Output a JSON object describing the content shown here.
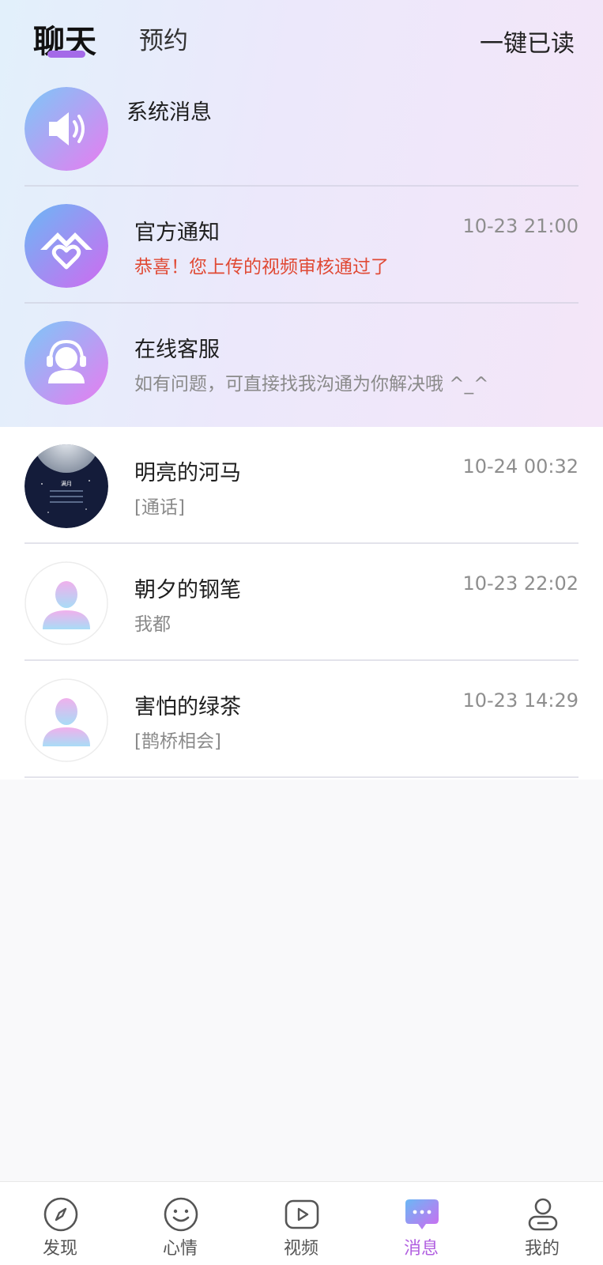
{
  "header": {
    "tabs": [
      {
        "label": "聊天",
        "active": true
      },
      {
        "label": "预约",
        "active": false
      }
    ],
    "mark_all_read": "一键已读"
  },
  "system_items": [
    {
      "name": "系统消息",
      "preview": "",
      "time": "",
      "icon": "speaker-icon"
    },
    {
      "name": "官方通知",
      "preview": "恭喜！您上传的视频审核通过了",
      "time": "10-23 21:00",
      "icon": "official-logo-icon"
    },
    {
      "name": "在线客服",
      "preview": "如有问题，可直接找我沟通为你解决哦 ^_^",
      "time": "",
      "icon": "headset-agent-icon"
    }
  ],
  "conversations": [
    {
      "name": "明亮的河马",
      "preview": "[通话]",
      "time": "10-24 00:32",
      "avatar_text": "满月"
    },
    {
      "name": "朝夕的钢笔",
      "preview": "我都",
      "time": "10-23 22:02"
    },
    {
      "name": "害怕的绿茶",
      "preview": "[鹊桥相会]",
      "time": "10-23 14:29"
    }
  ],
  "bottom_nav": [
    {
      "label": "发现",
      "icon": "compass-icon",
      "active": false
    },
    {
      "label": "心情",
      "icon": "smile-icon",
      "active": false
    },
    {
      "label": "视频",
      "icon": "video-play-icon",
      "active": false
    },
    {
      "label": "消息",
      "icon": "chat-bubble-icon",
      "active": true
    },
    {
      "label": "我的",
      "icon": "profile-icon",
      "active": false
    }
  ],
  "colors": {
    "accent": "#b15fe0",
    "notice_red": "#e04a35",
    "tab_underline": "#a46ae8"
  }
}
